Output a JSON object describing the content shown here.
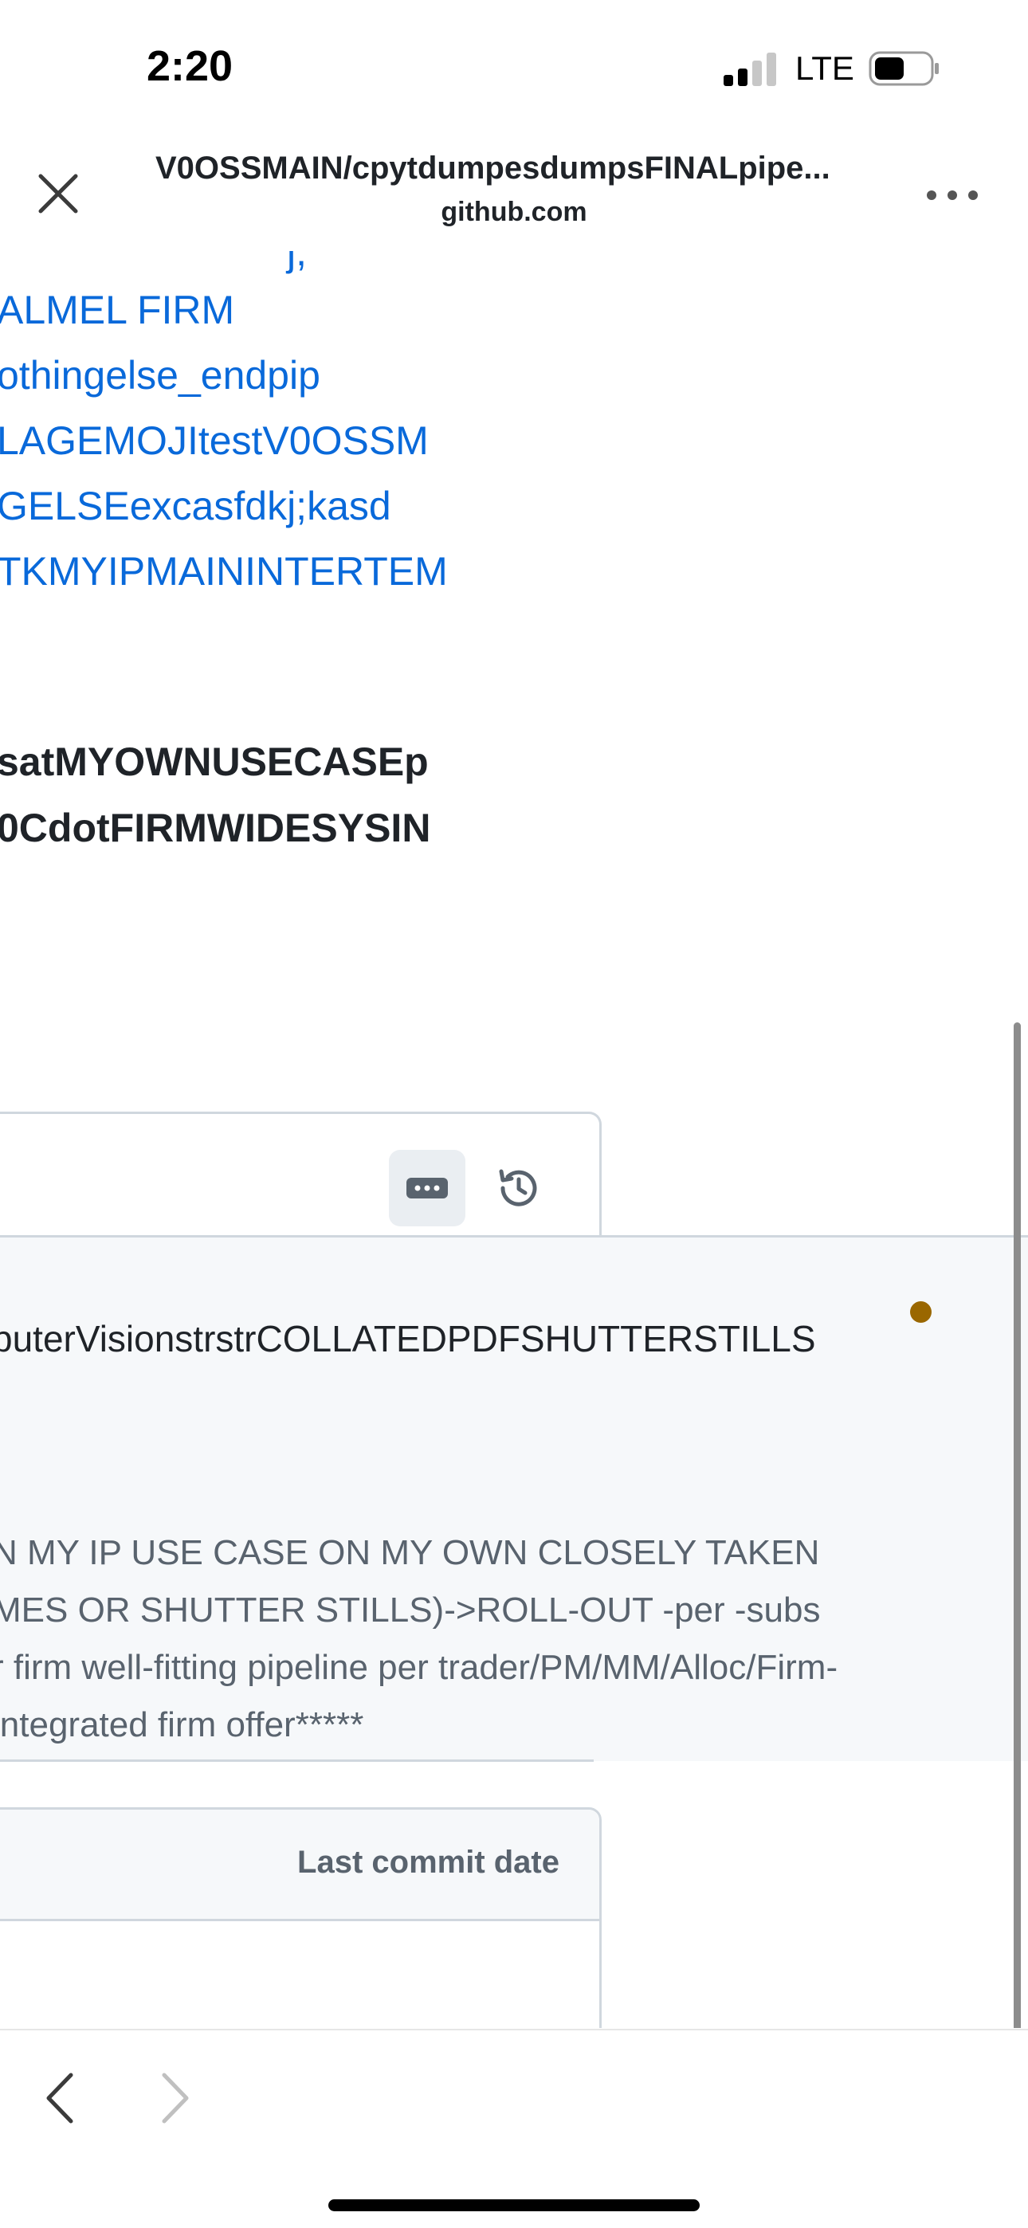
{
  "status_bar": {
    "time": "2:20",
    "network": "LTE",
    "icons": [
      "signal-icon",
      "battery-icon"
    ]
  },
  "title_bar": {
    "title": "V0OSSMAIN/cpytdumpesdumpsFINALpipe...",
    "domain": "github.com",
    "icons": [
      "close-icon",
      "more-icon"
    ]
  },
  "readme": {
    "partial_link": "j,",
    "links": [
      "ALMEL FIRM",
      "othingelse_endpip",
      "LAGEMOJItestV0OSSM",
      "GELSEexcasfdkj;kasd",
      "TKMYIPMAININTERTEM"
    ],
    "bold_lines": [
      "satMYOWNUSECASEp",
      "0CdotFIRMWIDESYSIN"
    ]
  },
  "file_box": {
    "icons": [
      "ellipsis-icon",
      "history-icon"
    ],
    "commit_title": "puterVisionstrstrCOLLATEDPDFSHUTTERSTILLS",
    "status_color": "#9a6700",
    "commit_description": [
      "N MY IP USE CASE ON MY OWN CLOSELY TAKEN",
      "MES OR SHUTTER STILLS)->ROLL-OUT -per -subs",
      "r firm well-fitting pipeline per trader/PM/MM/Alloc/Firm-",
      "integrated firm offer*****"
    ],
    "table_header": "Last commit date"
  },
  "toolbar": {
    "icons": [
      "chevron-left-icon",
      "chevron-right-icon"
    ]
  },
  "colors": {
    "link": "#0969da",
    "text": "#1f2328",
    "muted": "#59636e",
    "border": "#d0d7de",
    "panel_bg": "#f6f8fa"
  }
}
